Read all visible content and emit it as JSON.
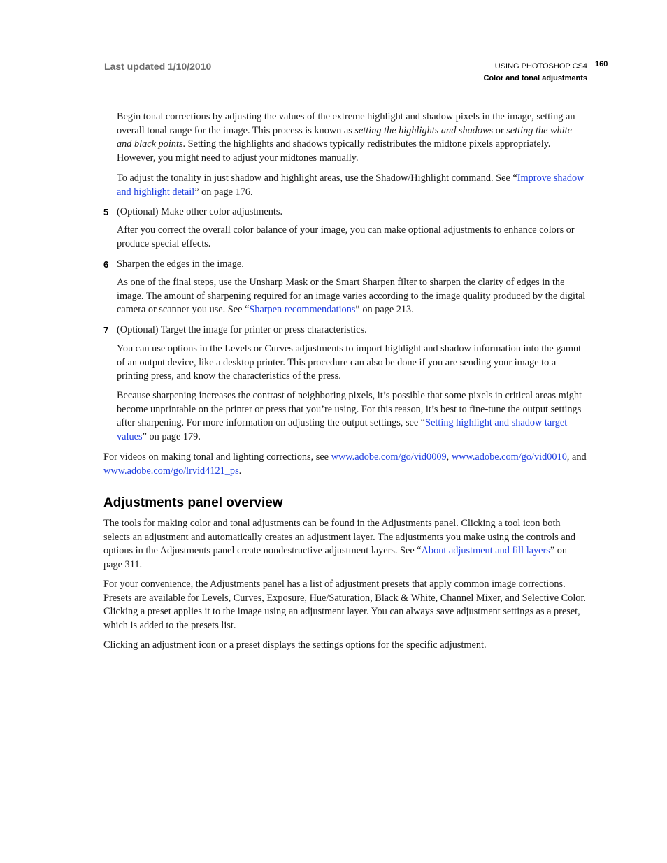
{
  "header": {
    "last_updated": "Last updated 1/10/2010",
    "book_title": "USING PHOTOSHOP CS4",
    "chapter_title": "Color and tonal adjustments",
    "page_number": "160"
  },
  "content": {
    "para1": {
      "a": "Begin tonal corrections by adjusting the values of the extreme highlight and shadow pixels in the image, setting an overall tonal range for the image. This process is known as ",
      "em1": "setting the highlights and shadows",
      "b": " or ",
      "em2": "setting the white and black points",
      "c": ". Setting the highlights and shadows typically redistributes the midtone pixels appropriately. However, you might need to adjust your midtones manually."
    },
    "para2": {
      "a": "To adjust the tonality in just shadow and highlight areas, use the Shadow/Highlight command. See “",
      "link": "Improve shadow and highlight detail",
      "b": "” on page 176."
    },
    "step5": {
      "num": "5",
      "text": "(Optional) Make other color adjustments."
    },
    "para3": "After you correct the overall color balance of your image, you can make optional adjustments to enhance colors or produce special effects.",
    "step6": {
      "num": "6",
      "text": "Sharpen the edges in the image."
    },
    "para4": {
      "a": "As one of the final steps, use the Unsharp Mask or the Smart Sharpen filter to sharpen the clarity of edges in the image. The amount of sharpening required for an image varies according to the image quality produced by the digital camera or scanner you use. See “",
      "link": "Sharpen recommendations",
      "b": "” on page 213."
    },
    "step7": {
      "num": "7",
      "text": "(Optional) Target the image for printer or press characteristics."
    },
    "para5": "You can use options in the Levels or Curves adjustments to import highlight and shadow information into the gamut of an output device, like a desktop printer. This procedure can also be done if you are sending your image to a printing press, and know the characteristics of the press.",
    "para6": {
      "a": "Because sharpening increases the contrast of neighboring pixels, it’s possible that some pixels in critical areas might become unprintable on the printer or press that you’re using. For this reason, it’s best to fine-tune the output settings after sharpening. For more information on adjusting the output settings, see “",
      "link": "Setting highlight and shadow target values",
      "b": "” on page 179."
    },
    "para7": {
      "a": "For videos on making tonal and lighting corrections, see ",
      "link1": "www.adobe.com/go/vid0009",
      "sep1": ", ",
      "link2": "www.adobe.com/go/vid0010",
      "sep2": ", and ",
      "link3": "www.adobe.com/go/lrvid4121_ps",
      "end": "."
    },
    "heading": "Adjustments panel overview",
    "para8": {
      "a": "The tools for making color and tonal adjustments can be found in the Adjustments panel. Clicking a tool icon both selects an adjustment and automatically creates an adjustment layer. The adjustments you make using the controls and options in the Adjustments panel create nondestructive adjustment layers. See “",
      "link": "About adjustment and fill layers",
      "b": "” on page 311."
    },
    "para9": "For your convenience, the Adjustments panel has a list of adjustment presets that apply common image corrections. Presets are available for Levels, Curves, Exposure, Hue/Saturation, Black & White, Channel Mixer, and Selective Color. Clicking a preset applies it to the image using an adjustment layer. You can always save adjustment settings as a preset, which is added to the presets list.",
    "para10": "Clicking an adjustment icon or a preset displays the settings options for the specific adjustment."
  },
  "colors": {
    "link": "#1f3fe0",
    "header_gray": "#6e6e6e",
    "text": "#1a1a1a"
  }
}
